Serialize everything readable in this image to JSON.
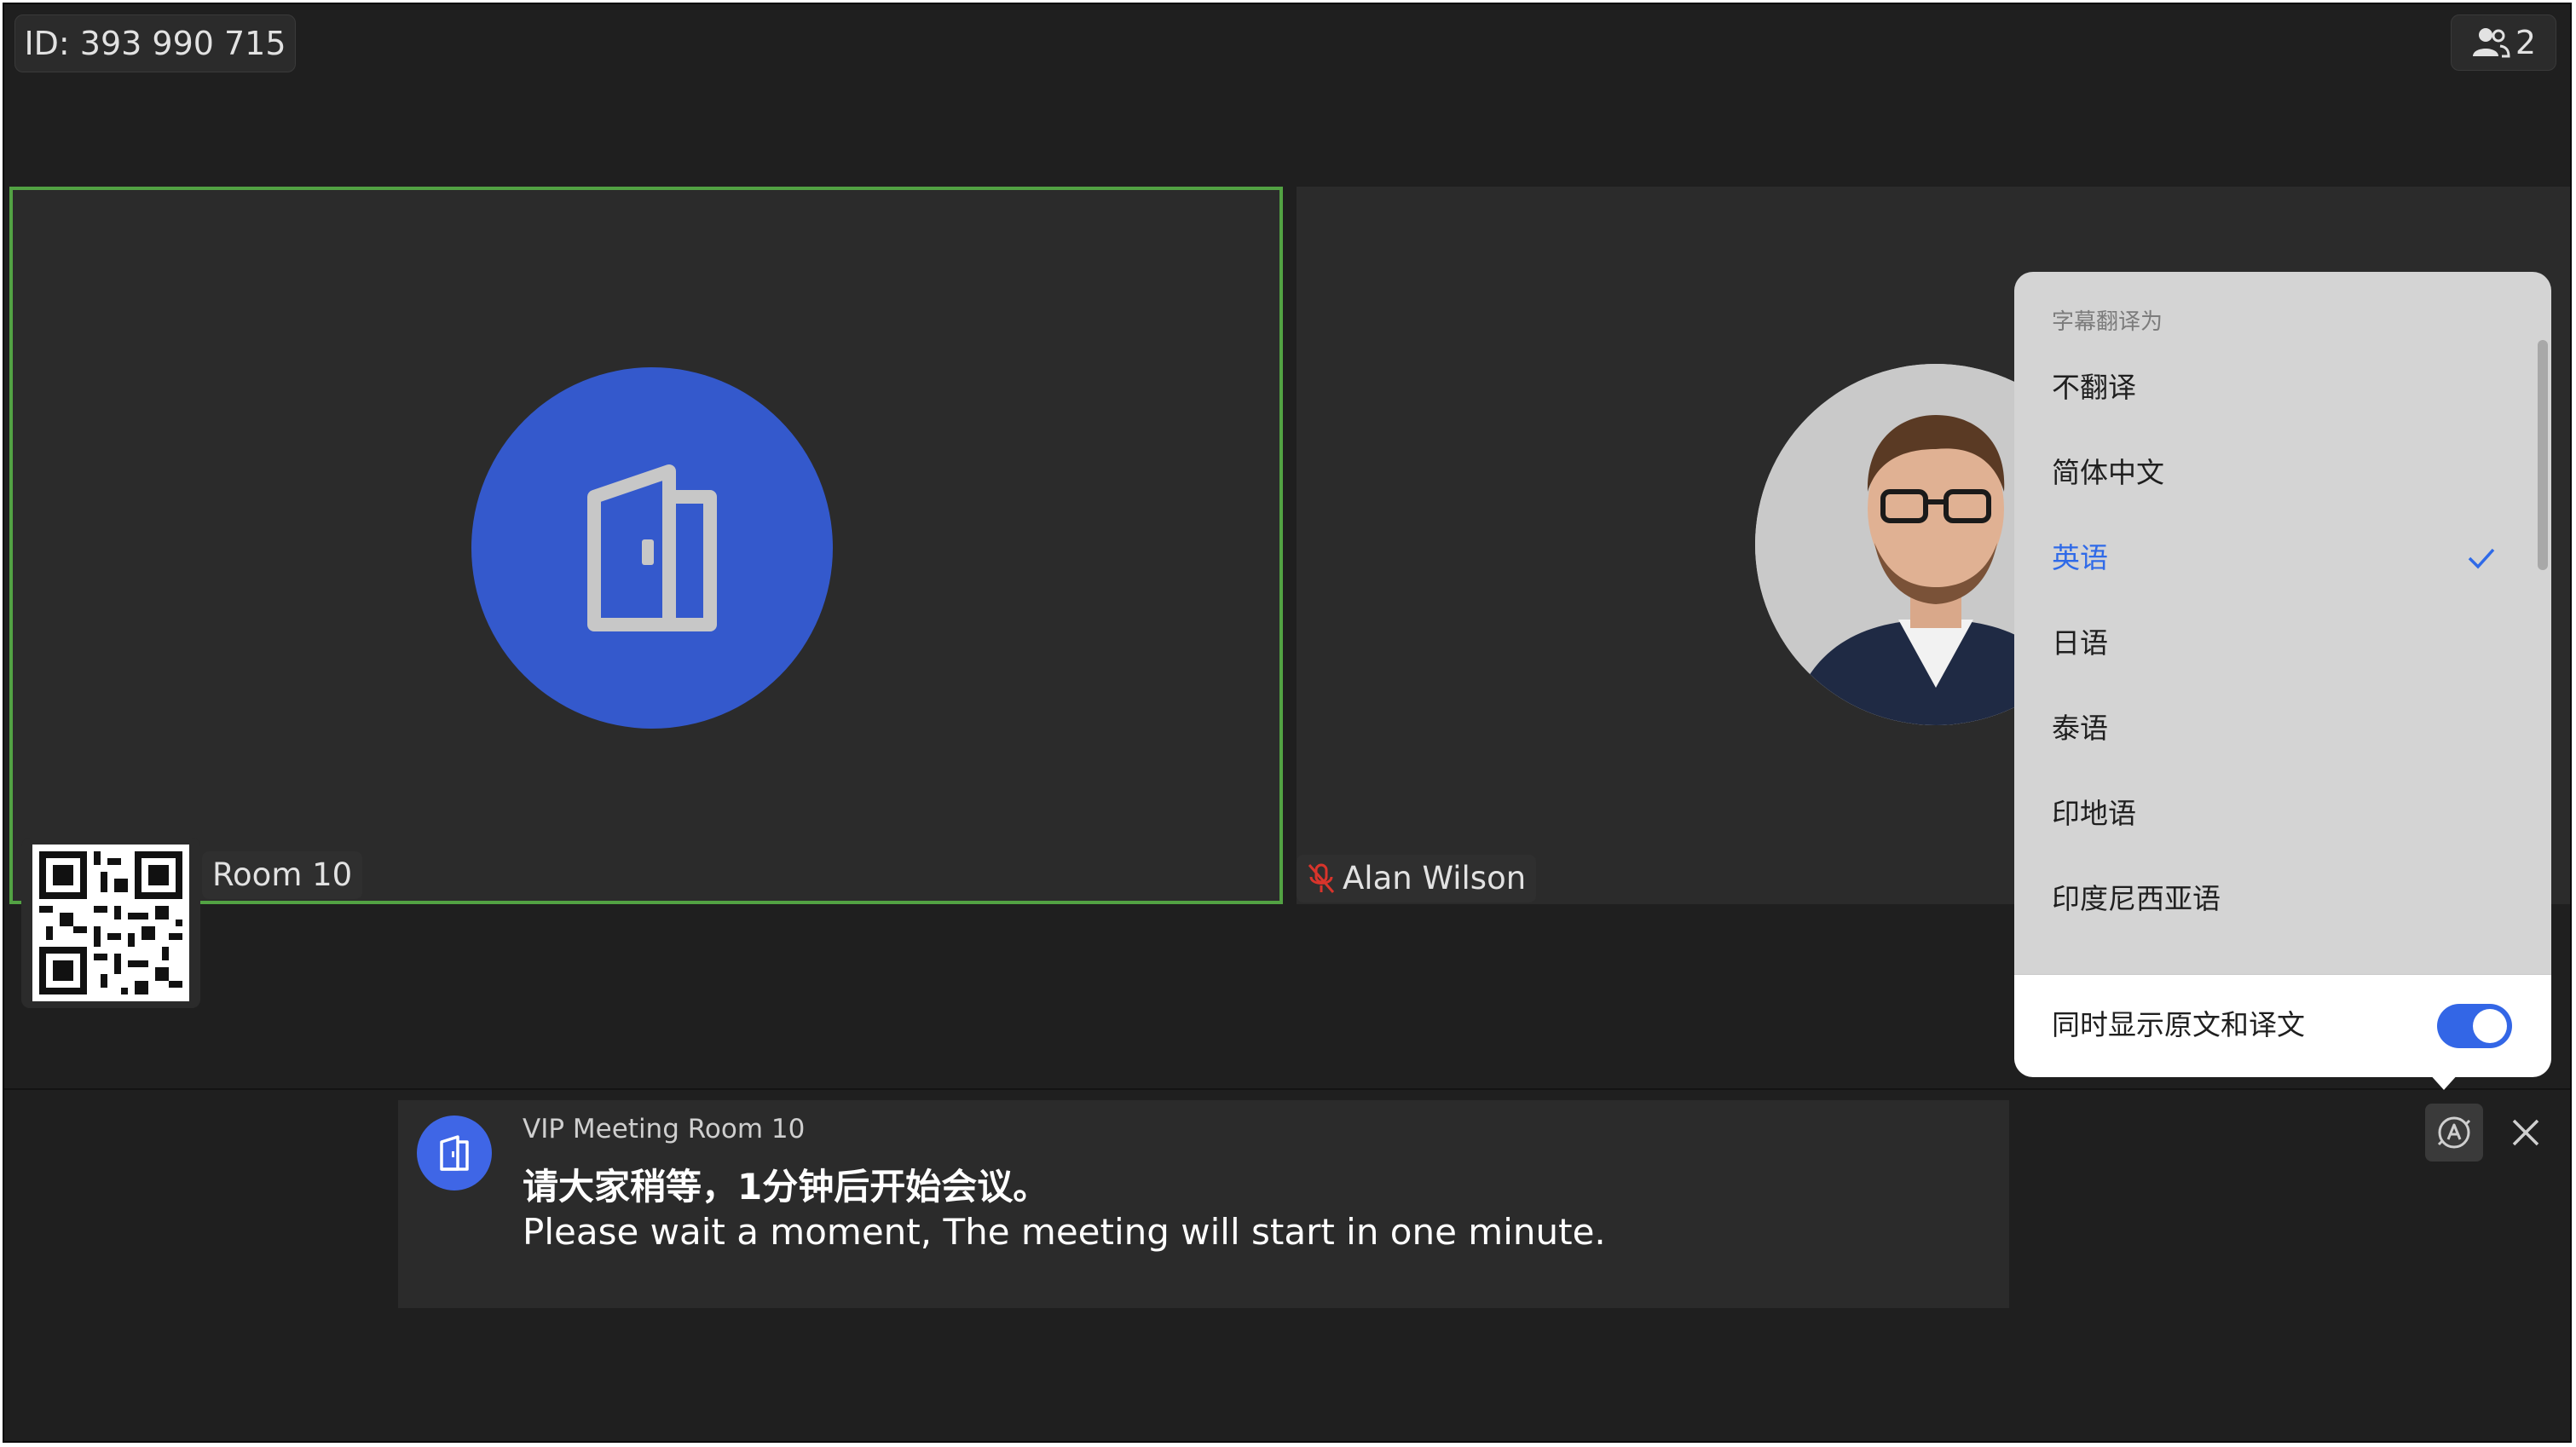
{
  "meeting": {
    "id_label": "ID: 393 990 715",
    "participant_count": "2"
  },
  "tiles": {
    "room": {
      "name": "Room 10"
    },
    "person": {
      "name": "Alan Wilson"
    }
  },
  "captions": {
    "speaker": "VIP Meeting Room 10",
    "line_cn": "请大家稍等，1分钟后开始会议。",
    "line_en": "Please wait a moment, The meeting will start in one minute."
  },
  "translate_menu": {
    "header": "字幕翻译为",
    "options": [
      {
        "label": "不翻译"
      },
      {
        "label": "简体中文"
      },
      {
        "label": "英语"
      },
      {
        "label": "日语"
      },
      {
        "label": "泰语"
      },
      {
        "label": "印地语"
      },
      {
        "label": "印度尼西亚语"
      }
    ],
    "selected": "英语",
    "footer_label": "同时显示原文和译文",
    "show_both": true
  },
  "colors": {
    "accent_blue": "#3366e6",
    "speaker_border": "#52a243",
    "background": "#1f1f1f",
    "tile_bg": "#2b2b2b",
    "muted_red": "#d9342b"
  },
  "icons": {
    "participants": "people-icon",
    "room": "door-icon",
    "mic": "mic-off-icon",
    "translate": "translate-icon",
    "close": "close-icon",
    "check": "check-icon"
  }
}
